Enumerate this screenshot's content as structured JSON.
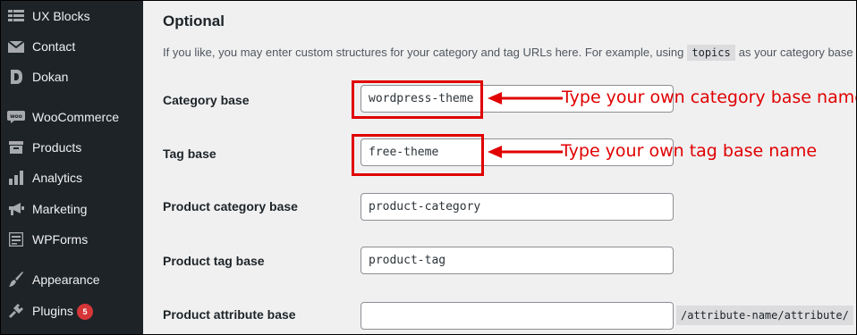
{
  "sidebar": {
    "items": [
      {
        "label": "UX Blocks",
        "icon": "grid-icon"
      },
      {
        "label": "Contact",
        "icon": "envelope-icon"
      },
      {
        "label": "Dokan",
        "icon": "dokan-icon"
      },
      {
        "label": "WooCommerce",
        "icon": "woocommerce-icon"
      },
      {
        "label": "Products",
        "icon": "archive-icon"
      },
      {
        "label": "Analytics",
        "icon": "bar-chart-icon"
      },
      {
        "label": "Marketing",
        "icon": "megaphone-icon"
      },
      {
        "label": "WPForms",
        "icon": "form-icon"
      },
      {
        "label": "Appearance",
        "icon": "paintbrush-icon"
      },
      {
        "label": "Plugins",
        "icon": "plug-icon",
        "badge": "5"
      }
    ]
  },
  "main": {
    "section_title": "Optional",
    "description_prefix": "If you like, you may enter custom structures for your category and tag URLs here. For example, using",
    "description_code": "topics",
    "description_suffix": "as your category base w",
    "fields": [
      {
        "label": "Category base",
        "value": "wordpress-theme"
      },
      {
        "label": "Tag base",
        "value": "free-theme"
      },
      {
        "label": "Product category base",
        "value": "product-category"
      },
      {
        "label": "Product tag base",
        "value": "product-tag"
      },
      {
        "label": "Product attribute base",
        "value": ""
      }
    ],
    "attribute_suffix": "/attribute-name/attribute/"
  },
  "annotations": {
    "category": "Type your own category base name",
    "tag": "Type your own tag base name",
    "color": "#e00000"
  },
  "colors": {
    "sidebar_bg": "#1d2327",
    "page_bg": "#f0f0f1",
    "badge": "#d63638"
  }
}
